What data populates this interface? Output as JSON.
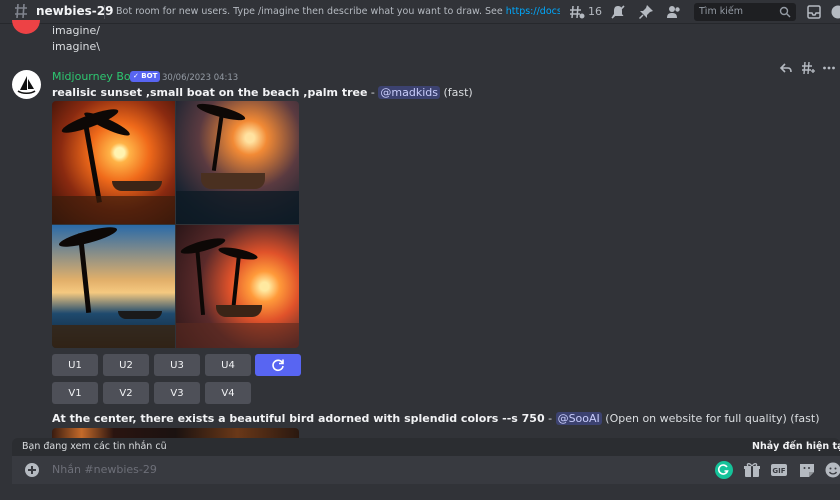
{
  "header": {
    "channel_name": "newbies-29",
    "topic_text": "Bot room for new users. Type /imagine then describe what you want to draw. See ",
    "topic_link": "https://docs.midjourn...",
    "threads_count": "16",
    "search_placeholder": "Tìm kiếm",
    "icons": [
      "hashtag-icon",
      "threads-icon",
      "mute-icon",
      "pin-icon",
      "members-icon",
      "search-icon",
      "inbox-icon",
      "help-icon"
    ]
  },
  "previous_message": {
    "line1": "imagine/",
    "line2": "imagine\\"
  },
  "message": {
    "author": "Midjourney Bot",
    "badge": "✓ BOT",
    "timestamp": "30/06/2023 04:13",
    "prompt": "realisic sunset ,small boat on the beach ,palm tree",
    "separator": " - ",
    "mention": "@madkids",
    "speed": "(fast)",
    "buttons_row1": [
      "U1",
      "U2",
      "U3",
      "U4"
    ],
    "buttons_row2": [
      "V1",
      "V2",
      "V3",
      "V4"
    ]
  },
  "message2": {
    "prompt": "At the center, there exists a beautiful bird adorned with splendid colors --s 750",
    "separator": " - ",
    "mention": "@SooAI",
    "suffix": "(Open on website for full quality) (fast)"
  },
  "jumpbar": {
    "left_text": "Bạn đang xem các tin nhắn cũ",
    "right_text": "Nhảy đến hiện tại"
  },
  "composer": {
    "placeholder": "Nhắn #newbies-29",
    "gif_label": "GIF"
  },
  "colors": {
    "background": "#313338",
    "username": "#2dc770",
    "blurple": "#5865f2",
    "link": "#00a8fc",
    "button": "#4e5058"
  }
}
